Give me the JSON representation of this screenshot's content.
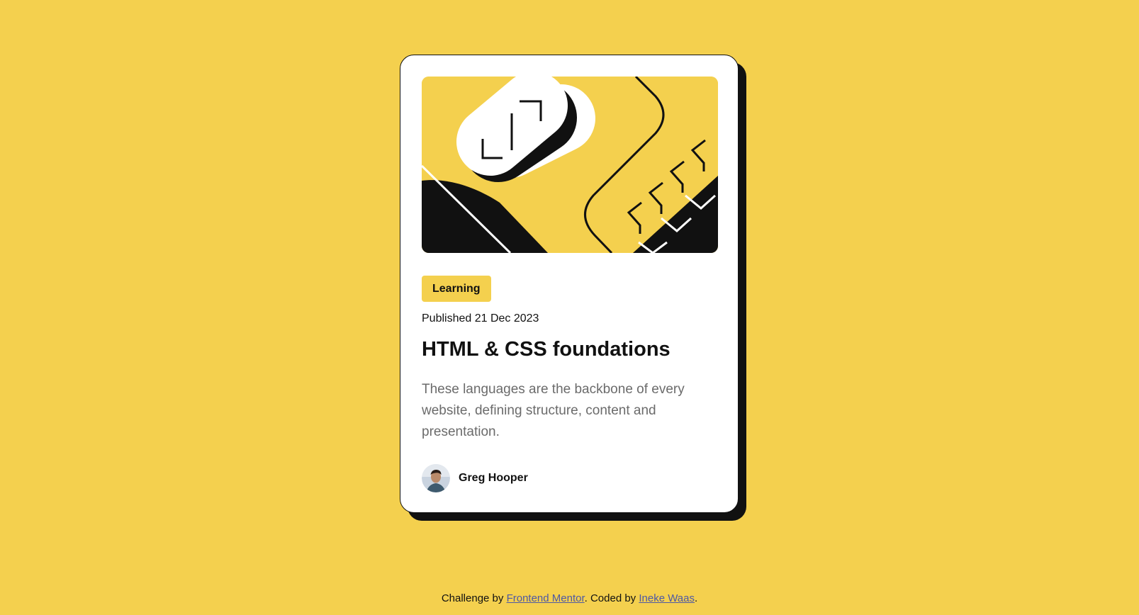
{
  "card": {
    "tag": "Learning",
    "published": "Published 21 Dec 2023",
    "title": "HTML & CSS foundations",
    "description": "These languages are the backbone of every website, defining structure, content and presentation.",
    "author": "Greg Hooper"
  },
  "footer": {
    "prefix": "Challenge by ",
    "mentor_link": "Frontend Mentor",
    "middle": ". Coded by ",
    "coder_link": "Ineke Waas",
    "suffix": "."
  },
  "icons": {
    "hero": "html-css-illustration",
    "avatar": "author-avatar"
  },
  "colors": {
    "background": "#F4D04E",
    "card": "#FFFFFF",
    "ink": "#111111",
    "muted": "#6B6B6B",
    "link": "#4D58A5"
  }
}
